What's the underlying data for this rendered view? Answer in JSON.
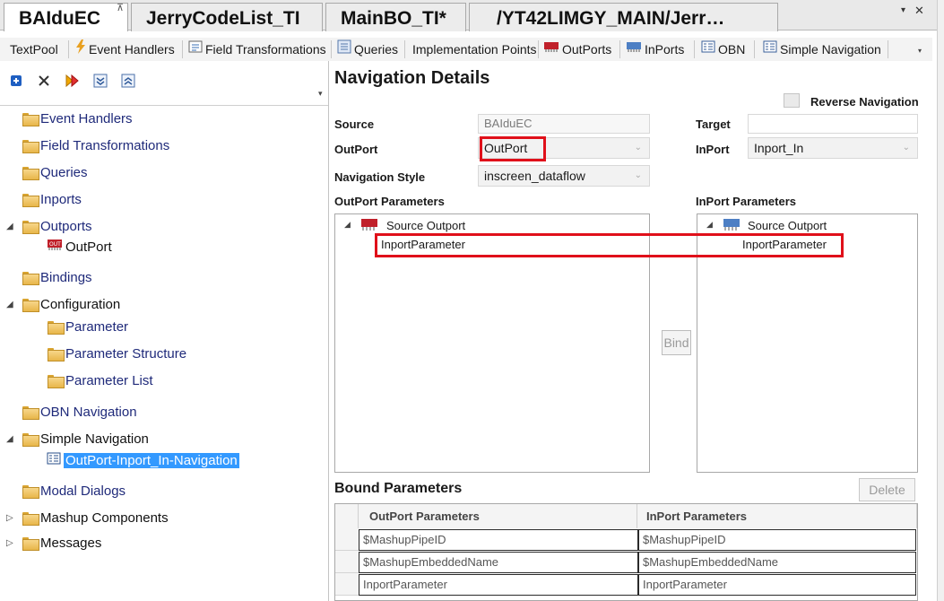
{
  "doc_tabs": [
    {
      "label": "BAIduEC",
      "active": true
    },
    {
      "label": "JerryCodeList_TI",
      "active": false
    },
    {
      "label": "MainBO_TI*",
      "active": false
    },
    {
      "label": "/YT42LIMGY_MAIN/Jerr…",
      "active": false
    }
  ],
  "tab_controls": {
    "overflow": "▾",
    "close": "✕",
    "pin": "⊼"
  },
  "toolbar": {
    "items": [
      "TextPool",
      "Event Handlers",
      "Field Transformations",
      "Queries",
      "Implementation Points",
      "OutPorts",
      "InPorts",
      "OBN",
      "Simple Navigation"
    ],
    "more": "▾"
  },
  "tree_toolbar": {
    "icons": [
      "add-icon",
      "delete-icon",
      "run-icon",
      "expand-all-icon",
      "collapse-all-icon"
    ],
    "more": "▾"
  },
  "tree": [
    {
      "label": "Event Handlers",
      "expander": ""
    },
    {
      "label": "Field Transformations",
      "expander": ""
    },
    {
      "label": "Queries",
      "expander": ""
    },
    {
      "label": "Inports",
      "expander": ""
    },
    {
      "label": "Outports",
      "expander": "◢"
    },
    {
      "label": "OutPort",
      "expander": ""
    },
    {
      "label": "Bindings",
      "expander": ""
    },
    {
      "label": "Configuration",
      "expander": "◢"
    },
    {
      "label": "Parameter",
      "expander": ""
    },
    {
      "label": "Parameter Structure",
      "expander": ""
    },
    {
      "label": "Parameter List",
      "expander": ""
    },
    {
      "label": "OBN Navigation",
      "expander": ""
    },
    {
      "label": "Simple Navigation",
      "expander": "◢"
    },
    {
      "label": "OutPort-Inport_In-Navigation",
      "expander": ""
    },
    {
      "label": "Modal Dialogs",
      "expander": ""
    },
    {
      "label": "Mashup Components",
      "expander": "▷"
    },
    {
      "label": "Messages",
      "expander": "▷"
    }
  ],
  "details": {
    "title": "Navigation Details",
    "reverse_navigation_label": "Reverse Navigation",
    "reverse_navigation_checked": false,
    "source_label": "Source",
    "source_value": "BAIduEC",
    "target_label": "Target",
    "target_value": "",
    "outport_label": "OutPort",
    "outport_value": "OutPort",
    "inport_label": "InPort",
    "inport_value": "Inport_In",
    "nav_style_label": "Navigation Style",
    "nav_style_value": "inscreen_dataflow",
    "outport_params_label": "OutPort Parameters",
    "inport_params_label": "InPort Parameters",
    "outport_tree": {
      "expander": "◢",
      "root": "Source Outport",
      "child": "InportParameter"
    },
    "inport_tree": {
      "expander": "◢",
      "root": "Source Outport",
      "child": "InportParameter"
    },
    "bind_label": "Bind",
    "caret": "⌄"
  },
  "bound": {
    "title": "Bound Parameters",
    "delete_label": "Delete",
    "columns": [
      "OutPort Parameters",
      "InPort Parameters"
    ],
    "rows": [
      [
        "$MashupPipeID",
        "$MashupPipeID"
      ],
      [
        "$MashupEmbeddedName",
        "$MashupEmbeddedName"
      ],
      [
        "InportParameter",
        "InportParameter"
      ]
    ]
  },
  "colors": {
    "highlight_box": "#e0101a",
    "selection": "#3399ff",
    "tree_text": "#1f2a7a"
  }
}
